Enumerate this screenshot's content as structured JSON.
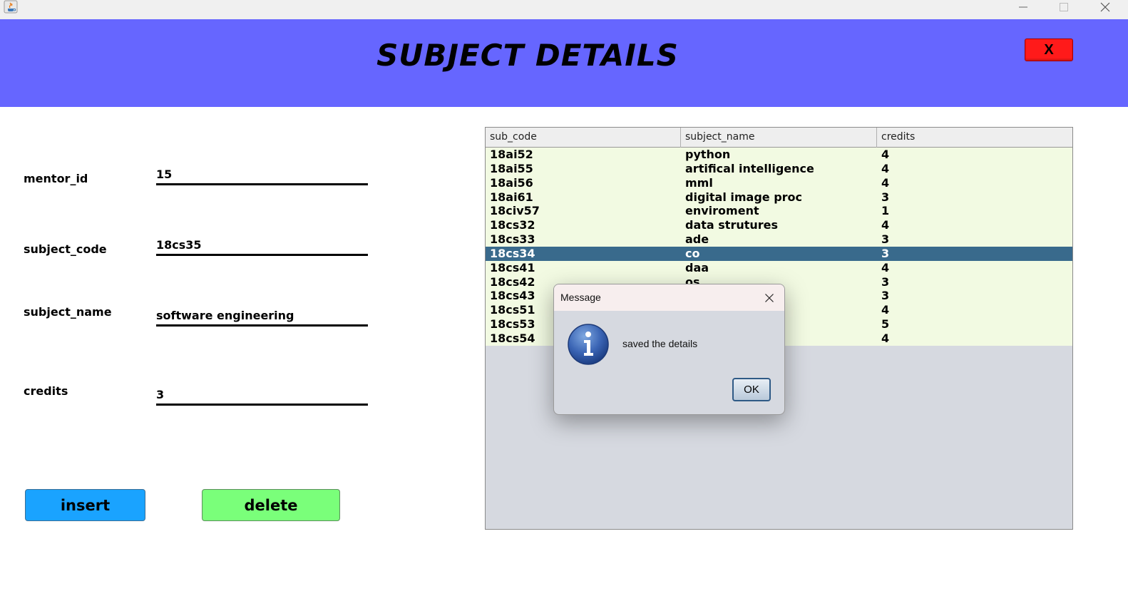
{
  "window": {
    "minimize_icon": "minimize-icon",
    "maximize_icon": "maximize-icon",
    "close_icon": "close-icon"
  },
  "header": {
    "title": "SUBJECT DETAILS",
    "close_label": "X",
    "background": "#6666ff",
    "close_color": "#ff1a1a"
  },
  "form": {
    "mentor_id_label": "mentor_id",
    "mentor_id_value": "15",
    "subject_code_label": "subject_code",
    "subject_code_value": "18cs35",
    "subject_name_label": "subject_name",
    "subject_name_value": "software engineering",
    "credits_label": "credits",
    "credits_value": "3"
  },
  "actions": {
    "insert_label": "insert",
    "delete_label": "delete",
    "insert_color": "#1aa3ff",
    "delete_color": "#7aff7a"
  },
  "table": {
    "columns": [
      "sub_code",
      "subject_name",
      "credits"
    ],
    "selected_row": 7,
    "rows": [
      [
        "18ai52",
        "python",
        "4"
      ],
      [
        "18ai55",
        "artifical  intelligence",
        "4"
      ],
      [
        "18ai56",
        "mml",
        "4"
      ],
      [
        "18ai61",
        "digital image proc",
        "3"
      ],
      [
        "18civ57",
        "enviroment",
        "1"
      ],
      [
        "18cs32",
        "data strutures",
        "4"
      ],
      [
        "18cs33",
        "ade",
        "3"
      ],
      [
        "18cs34",
        "co",
        "3"
      ],
      [
        "18cs41",
        "daa",
        "4"
      ],
      [
        "18cs42",
        "os",
        "3"
      ],
      [
        "18cs43",
        "",
        "3"
      ],
      [
        "18cs51",
        "",
        "4"
      ],
      [
        "18cs53",
        "",
        "5"
      ],
      [
        "18cs54",
        "",
        "4"
      ]
    ]
  },
  "dialog": {
    "title": "Message",
    "message": "saved the details",
    "ok_label": "OK",
    "icon": "info-icon"
  }
}
